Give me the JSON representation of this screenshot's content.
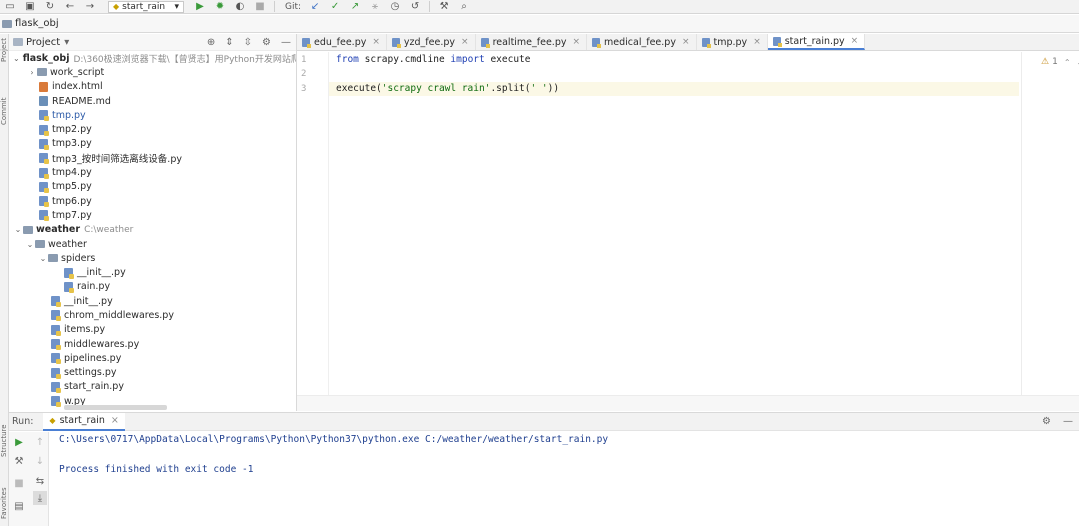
{
  "toolbar": {
    "run_config": "start_rain",
    "git_label": "Git:"
  },
  "navbar": {
    "breadcrumb": "flask_obj"
  },
  "side_strip": {
    "project": "Project",
    "commit": "Commit",
    "structure": "Structure",
    "favorites": "Favorites"
  },
  "project_panel": {
    "title": "Project",
    "tree": [
      {
        "label": "flask_obj",
        "hint": "D:\\360极速浏览器下载\\【曾贤志】用Python开发网站爬",
        "type": "root",
        "expanded": true
      },
      {
        "label": "work_script",
        "type": "folder",
        "expanded": false
      },
      {
        "label": "index.html",
        "type": "html"
      },
      {
        "label": "README.md",
        "type": "md"
      },
      {
        "label": "tmp.py",
        "type": "py",
        "highlight": true
      },
      {
        "label": "tmp2.py",
        "type": "py"
      },
      {
        "label": "tmp3.py",
        "type": "py"
      },
      {
        "label": "tmp3_按时间筛选离线设备.py",
        "type": "py"
      },
      {
        "label": "tmp4.py",
        "type": "py"
      },
      {
        "label": "tmp5.py",
        "type": "py"
      },
      {
        "label": "tmp6.py",
        "type": "py"
      },
      {
        "label": "tmp7.py",
        "type": "py"
      },
      {
        "label": "weather",
        "hint": "C:\\weather",
        "type": "root",
        "expanded": true
      },
      {
        "label": "weather",
        "type": "folder",
        "expanded": true
      },
      {
        "label": "spiders",
        "type": "folder",
        "expanded": true
      },
      {
        "label": "__init__.py",
        "type": "py"
      },
      {
        "label": "rain.py",
        "type": "py"
      },
      {
        "label": "__init__.py",
        "type": "py"
      },
      {
        "label": "chrom_middlewares.py",
        "type": "py"
      },
      {
        "label": "items.py",
        "type": "py"
      },
      {
        "label": "middlewares.py",
        "type": "py"
      },
      {
        "label": "pipelines.py",
        "type": "py"
      },
      {
        "label": "settings.py",
        "type": "py"
      },
      {
        "label": "start_rain.py",
        "type": "py"
      },
      {
        "label": "w.py",
        "type": "py"
      }
    ]
  },
  "editor_tabs": [
    {
      "label": "edu_fee.py",
      "active": false
    },
    {
      "label": "yzd_fee.py",
      "active": false
    },
    {
      "label": "realtime_fee.py",
      "active": false
    },
    {
      "label": "medical_fee.py",
      "active": false
    },
    {
      "label": "tmp.py",
      "active": false
    },
    {
      "label": "start_rain.py",
      "active": true
    }
  ],
  "editor": {
    "line_numbers": [
      "1",
      "2",
      "3"
    ],
    "line1": {
      "kw1": "from",
      "mod": " scrapy.cmdline ",
      "kw2": "import",
      "name": " execute"
    },
    "line3": {
      "pre": "execute(",
      "str1": "'scrapy crawl rain'",
      "mid": ".split(",
      "str2": "' '",
      "post": "))"
    },
    "warning_count": "1"
  },
  "run_panel": {
    "label": "Run:",
    "tab": "start_rain",
    "console": [
      "C:\\Users\\0717\\AppData\\Local\\Programs\\Python\\Python37\\python.exe C:/weather/weather/start_rain.py",
      "",
      "Process finished with exit code -1"
    ]
  }
}
